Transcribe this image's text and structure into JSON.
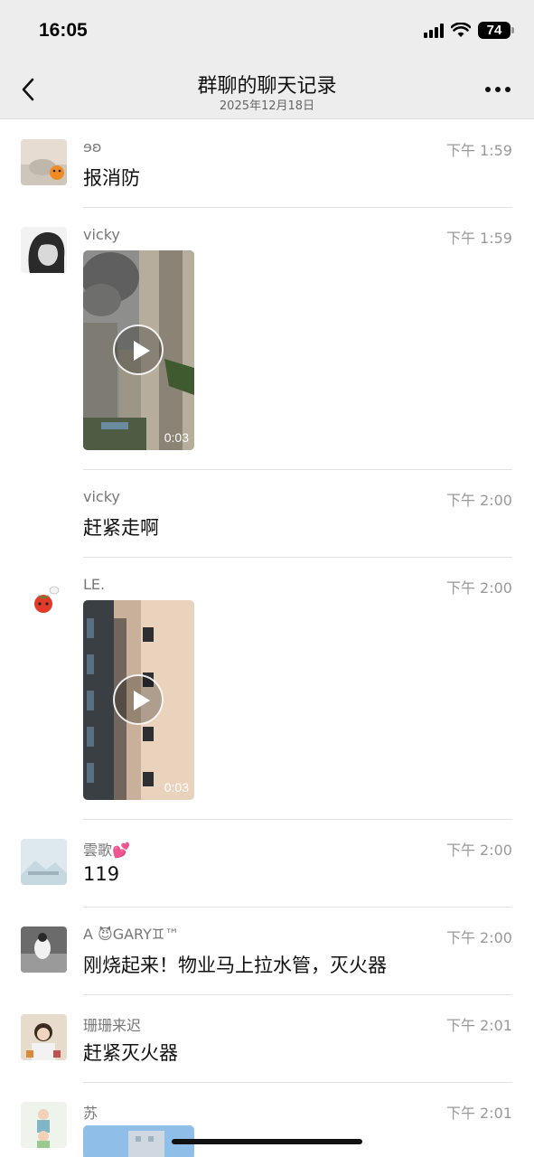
{
  "status": {
    "time": "16:05",
    "battery": "74"
  },
  "nav": {
    "title": "群聊的聊天记录",
    "subtitle": "2025年12月18日"
  },
  "messages": [
    {
      "sender": "ɘʚ",
      "time": "下午 1:59",
      "text": "报消防"
    },
    {
      "sender": "vicky",
      "time": "下午 1:59",
      "video_duration": "0:03"
    },
    {
      "sender": "vicky",
      "time": "下午 2:00",
      "text": "赶紧走啊"
    },
    {
      "sender": "LE.",
      "time": "下午 2:00",
      "video_duration": "0:03"
    },
    {
      "sender": "雲歌💕",
      "time": "下午 2:00",
      "text": "119"
    },
    {
      "sender": "A 😈GARY♊™",
      "time": "下午 2:00",
      "text": "刚烧起来！物业马上拉水管，灭火器"
    },
    {
      "sender": "珊珊来迟",
      "time": "下午 2:01",
      "text": "赶紧灭火器"
    },
    {
      "sender": "苏",
      "time": "下午 2:01"
    }
  ]
}
